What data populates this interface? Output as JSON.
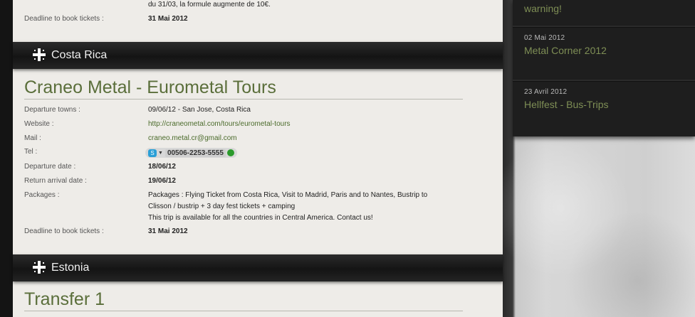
{
  "top_block": {
    "partial_text": "du 31/03, la formule augmente de 10€.",
    "deadline_label": "Deadline to book tickets :",
    "deadline_value": "31 Mai 2012"
  },
  "sections": [
    {
      "country": "Costa Rica",
      "title": "Craneo Metal - Eurometal Tours",
      "fields": {
        "departure_towns_label": "Departure towns :",
        "departure_towns_value": "09/06/12 - San Jose, Costa Rica",
        "website_label": "Website :",
        "website_value": "http://craneometal.com/tours/eurometal-tours",
        "mail_label": "Mail :",
        "mail_value": "craneo.metal.cr@gmail.com",
        "tel_label": "Tel :",
        "tel_value": "00506-2253-5555",
        "departure_date_label": "Departure date :",
        "departure_date_value": "18/06/12",
        "return_label": "Return arrival date :",
        "return_value": "19/06/12",
        "packages_label": "Packages :",
        "packages_line1": "Packages : Flying Ticket from Costa Rica, Visit to Madrid, Paris and to Nantes, Bustrip to",
        "packages_line2": "Clisson / bustrip + 3 day fest tickets + camping",
        "packages_line3": "This trip is available for all the countries in Central America. Contact us!",
        "deadline_label": "Deadline to book tickets :",
        "deadline_value": "31 Mai 2012"
      }
    },
    {
      "country": "Estonia",
      "title": "Transfer 1"
    }
  ],
  "sidebar_news": [
    {
      "date": "",
      "title": "warning!"
    },
    {
      "date": "02 Mai 2012",
      "title": "Metal Corner 2012"
    },
    {
      "date": "23 Avril 2012",
      "title": "Hellfest - Bus-Trips"
    }
  ],
  "icons": [
    "cross-icon",
    "skype-icon",
    "call-icon"
  ]
}
